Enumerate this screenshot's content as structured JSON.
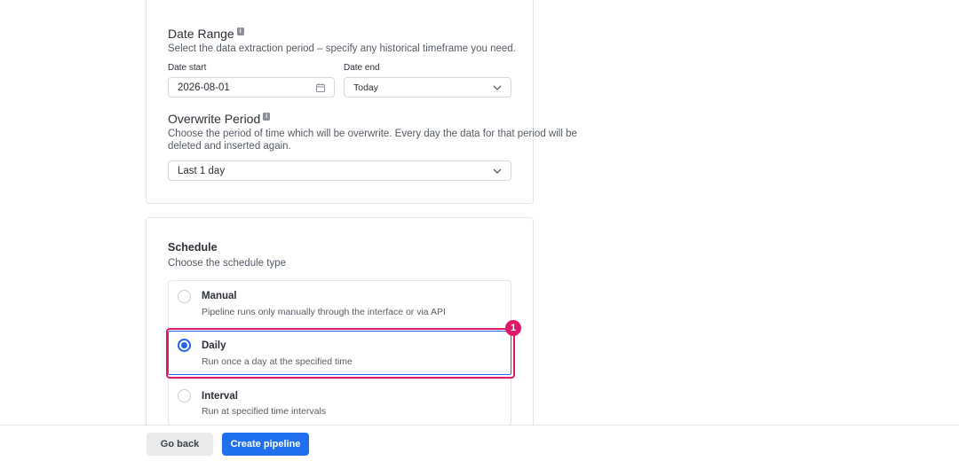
{
  "date_range": {
    "title": "Date Range",
    "description": "Select the data extraction period – specify any historical timeframe you need.",
    "date_start_label": "Date start",
    "date_start_value": "2026-08-01",
    "date_end_label": "Date end",
    "date_end_value": "Today"
  },
  "overwrite": {
    "title": "Overwrite Period",
    "description_line1": "Choose the period of time which will be overwrite. Every day the data for that period will be",
    "description_line2": "deleted and inserted again.",
    "value": "Last 1 day"
  },
  "schedule": {
    "title": "Schedule",
    "description": "Choose the schedule type",
    "options": [
      {
        "title": "Manual",
        "description": "Pipeline runs only manually through the interface or via API",
        "selected": false
      },
      {
        "title": "Daily",
        "description": "Run once a day at the specified time",
        "selected": true
      },
      {
        "title": "Interval",
        "description": "Run at specified time intervals",
        "selected": false
      }
    ]
  },
  "annotation": {
    "badge": "1",
    "color": "#e0196b"
  },
  "footer": {
    "back_label": "Go back",
    "create_label": "Create pipeline"
  },
  "colors": {
    "accent": "#1f6fee",
    "highlight": "#e0196b"
  },
  "icons": {
    "date_start_trail": "calendar-icon",
    "dropdown_trail": "chevron-down-icon",
    "info": "info-icon"
  }
}
